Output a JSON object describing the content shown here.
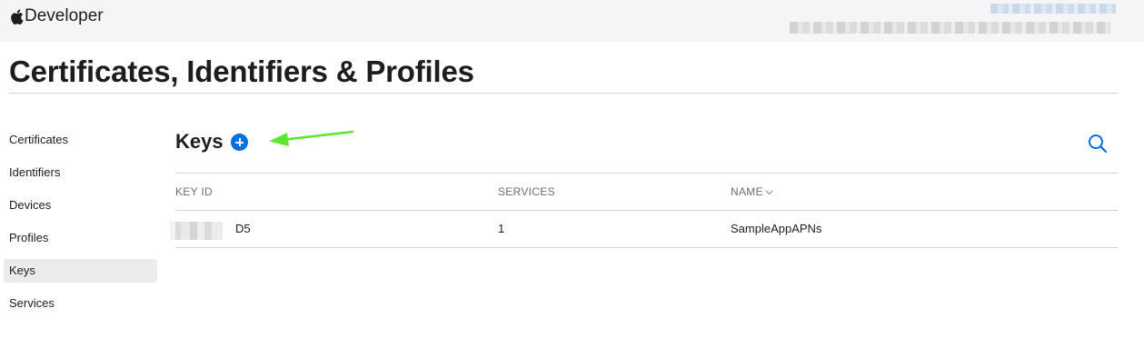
{
  "header": {
    "brand": "Developer",
    "logo_icon": "apple-logo-icon"
  },
  "page": {
    "title": "Certificates, Identifiers & Profiles"
  },
  "sidebar": {
    "items": [
      {
        "label": "Certificates",
        "selected": false
      },
      {
        "label": "Identifiers",
        "selected": false
      },
      {
        "label": "Devices",
        "selected": false
      },
      {
        "label": "Profiles",
        "selected": false
      },
      {
        "label": "Keys",
        "selected": true
      },
      {
        "label": "Services",
        "selected": false
      }
    ]
  },
  "section": {
    "title": "Keys",
    "add_icon": "plus-circle-icon",
    "search_icon": "search-icon",
    "annotation_icon": "green-arrow-icon"
  },
  "table": {
    "columns": [
      "KEY ID",
      "SERVICES",
      "NAME"
    ],
    "sort_column": "NAME",
    "sort_icon": "chevron-down-icon",
    "rows": [
      {
        "key_id_visible": "D5",
        "services": "1",
        "name": "SampleAppAPNs"
      }
    ]
  },
  "colors": {
    "accent": "#0071e3",
    "annotation_arrow": "#5ee632",
    "topbar_bg": "#f5f5f7",
    "selected_bg": "#ebebeb"
  }
}
